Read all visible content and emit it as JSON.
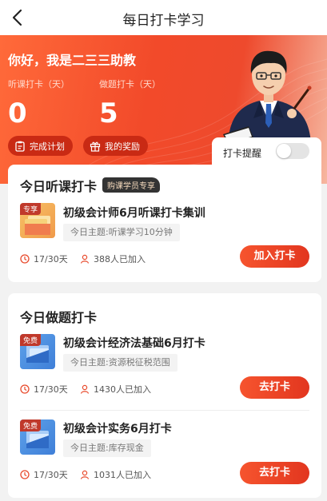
{
  "nav": {
    "title": "每日打卡学习"
  },
  "hero": {
    "greeting": "你好，我是二三三助教",
    "listen_label": "听课打卡（天）",
    "listen_value": "0",
    "practice_label": "做题打卡（天）",
    "practice_value": "5",
    "plan_button": "完成计划",
    "reward_button": "我的奖励",
    "remind_label": "打卡提醒",
    "remind_on": false
  },
  "listen_card": {
    "title": "今日听课打卡",
    "badge": "购课学员专享",
    "course": {
      "tag": "专享",
      "title": "初级会计师6月听课打卡集训",
      "topic": "今日主题:听课学习10分钟",
      "days": "17/30天",
      "joined": "388人已加入",
      "button": "加入打卡"
    }
  },
  "practice_card": {
    "title": "今日做题打卡",
    "courses": [
      {
        "tag": "免费",
        "title": "初级会计经济法基础6月打卡",
        "topic": "今日主题:资源税征税范围",
        "days": "17/30天",
        "joined": "1430人已加入",
        "button": "去打卡"
      },
      {
        "tag": "免费",
        "title": "初级会计实务6月打卡",
        "topic": "今日主题:库存现金",
        "days": "17/30天",
        "joined": "1031人已加入",
        "button": "去打卡"
      }
    ]
  },
  "colors": {
    "accent": "#ef4a2b",
    "button": "#e83d22",
    "pill": "#c92a14"
  }
}
